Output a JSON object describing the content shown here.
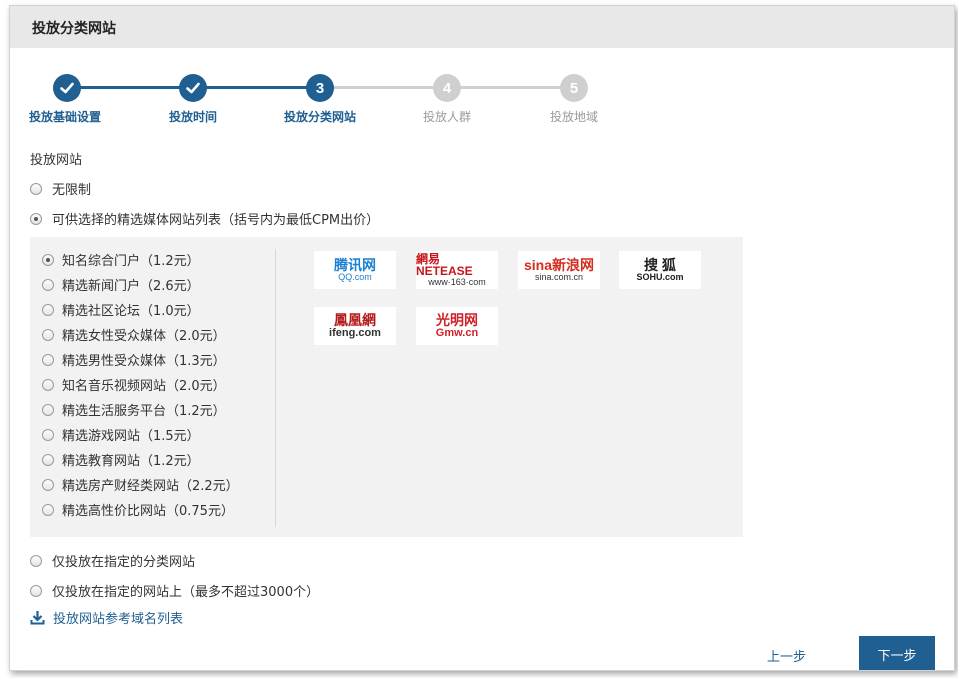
{
  "header": {
    "title": "投放分类网站"
  },
  "steps": [
    {
      "number": "1",
      "label": "投放基础设置",
      "state": "done"
    },
    {
      "number": "2",
      "label": "投放时间",
      "state": "done"
    },
    {
      "number": "3",
      "label": "投放分类网站",
      "state": "active"
    },
    {
      "number": "4",
      "label": "投放人群",
      "state": "pending"
    },
    {
      "number": "5",
      "label": "投放地域",
      "state": "pending"
    }
  ],
  "section": {
    "label": "投放网站"
  },
  "options": {
    "unlimited": {
      "label": "无限制",
      "checked": false
    },
    "curated": {
      "label": "可供选择的精选媒体网站列表（括号内为最低CPM出价）",
      "checked": true
    },
    "category_only": {
      "label": "仅投放在指定的分类网站",
      "checked": false
    },
    "specified_sites": {
      "label": "仅投放在指定的网站上（最多不超过3000个）",
      "checked": false
    }
  },
  "categories": [
    {
      "label": "知名综合门户（1.2元）",
      "checked": true
    },
    {
      "label": "精选新闻门户（2.6元）",
      "checked": false
    },
    {
      "label": "精选社区论坛（1.0元）",
      "checked": false
    },
    {
      "label": "精选女性受众媒体（2.0元）",
      "checked": false
    },
    {
      "label": "精选男性受众媒体（1.3元）",
      "checked": false
    },
    {
      "label": "知名音乐视频网站（2.0元）",
      "checked": false
    },
    {
      "label": "精选生活服务平台（1.2元）",
      "checked": false
    },
    {
      "label": "精选游戏网站（1.5元）",
      "checked": false
    },
    {
      "label": "精选教育网站（1.2元）",
      "checked": false
    },
    {
      "label": "精选房产财经类网站（2.2元）",
      "checked": false
    },
    {
      "label": "精选高性价比网站（0.75元）",
      "checked": false
    }
  ],
  "logos": {
    "tencent": {
      "main": "腾讯网",
      "sub": "QQ.com",
      "color": "#1a7fd0"
    },
    "netease": {
      "main": "網易 NETEASE",
      "sub": "www·163·com",
      "color": "#c8161d"
    },
    "sina": {
      "main": "sina新浪网",
      "sub": "sina.com.cn",
      "color": "#d52b1e"
    },
    "sohu": {
      "main": "搜 狐",
      "sub": "SOHU.com",
      "color": "#222222"
    },
    "ifeng": {
      "main": "鳳凰網",
      "sub": "ifeng.com",
      "color": "#b31b1b"
    },
    "gmw": {
      "main": "光明网",
      "sub": "Gmw.cn",
      "color": "#d0202a"
    }
  },
  "download": {
    "label": "投放网站参考域名列表",
    "icon": "download-icon"
  },
  "buttons": {
    "prev": "上一步",
    "next": "下一步"
  },
  "colors": {
    "primary": "#1f5f91",
    "pending": "#cfcfcf",
    "panel": "#f2f2f2",
    "header": "#e8e8e8"
  }
}
